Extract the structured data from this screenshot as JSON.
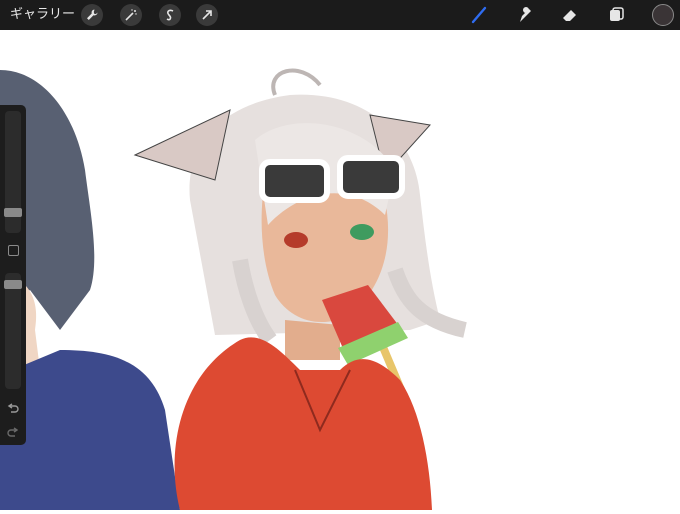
{
  "toolbar": {
    "gallery_label": "ギャラリー",
    "left_tools": [
      "wrench-icon",
      "magic-wand-icon",
      "selection-icon",
      "transform-arrow-icon"
    ],
    "right_tools": [
      "brush-icon",
      "smudge-icon",
      "eraser-icon",
      "layers-icon"
    ],
    "active_tool": "brush-icon",
    "accent_color": "#2f6cf0",
    "current_color": "#3a3436"
  },
  "sidebar": {
    "size_slider_label": "size-slider",
    "opacity_slider_label": "opacity-slider",
    "modify_button": "modify-square-icon",
    "undo": "undo-icon",
    "redo": "redo-icon"
  },
  "canvas": {
    "background_color": "#ffffff",
    "content": "illustration"
  }
}
